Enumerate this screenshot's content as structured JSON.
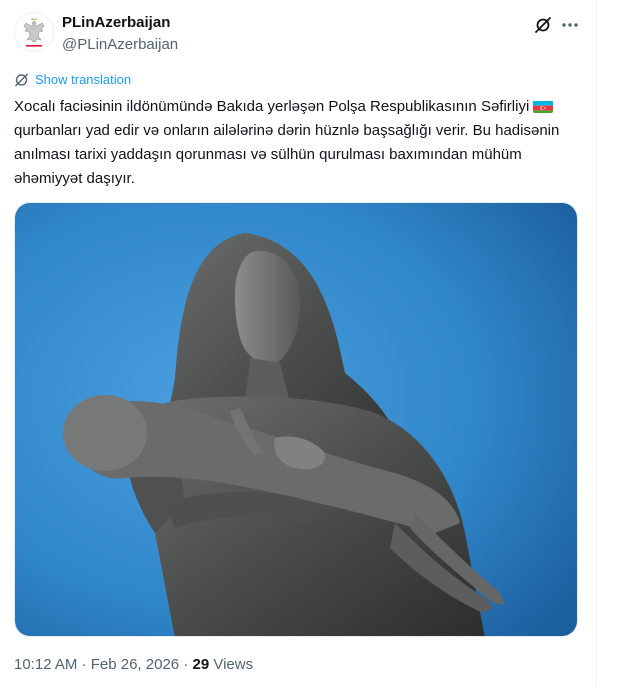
{
  "author": {
    "display_name": "PLinAzerbaijan",
    "handle": "@PLinAzerbaijan"
  },
  "icons": {
    "avatar": "polish-eagle-emblem",
    "grok": "grok-icon",
    "more": "more-icon",
    "translate": "translate-icon",
    "flag": "azerbaijan-flag-emoji"
  },
  "translation": {
    "label": "Show translation"
  },
  "tweet": {
    "text_part1": "Xocalı faciəsinin ildönümündə Bakıda yerləşən Polşa Respublikasının Səfirliyi",
    "text_part2": "qurbanları yad edir və onların ailələrinə dərin hüznlə başsağlığı verir. Bu hadisənin anılması tarixi yaddaşın qorunması və sülhün qurulması baxımından mühüm əhəmiyyət daşıyır."
  },
  "media": {
    "subject": "Mother monument statue holding child against blue sky"
  },
  "meta": {
    "time": "10:12 AM",
    "separator": " · ",
    "date": "Feb 26, 2026",
    "views_count": "29",
    "views_label": " Views"
  },
  "colors": {
    "accent": "#1d9bf0",
    "secondary_text": "#536471",
    "sky": "#2f86c8"
  }
}
